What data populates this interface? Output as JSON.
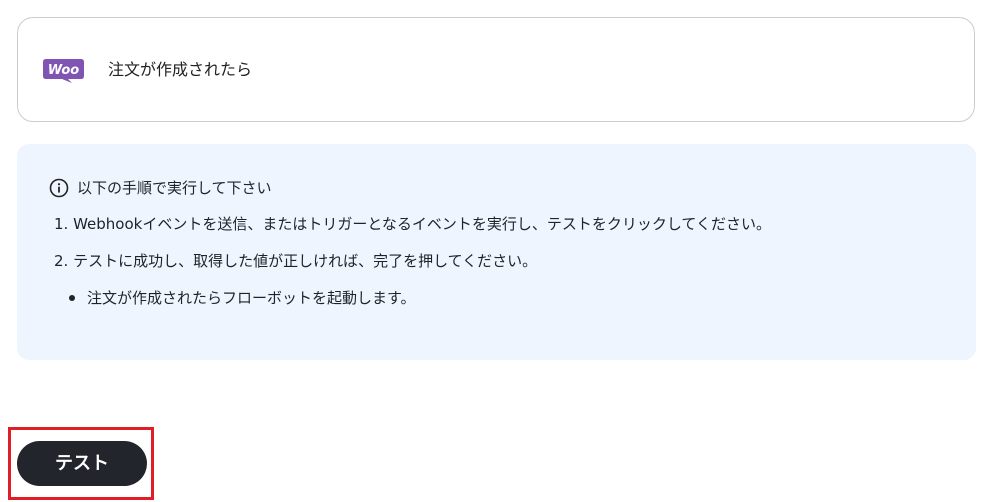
{
  "trigger": {
    "app_icon": "woocommerce-logo",
    "logo_text": "Woo",
    "label": "注文が作成されたら"
  },
  "instructions": {
    "icon": "info-icon",
    "heading": "以下の手順で実行して下さい",
    "steps": [
      "1. Webhookイベントを送信、またはトリガーとなるイベントを実行し、テストをクリックしてください。",
      "2. テストに成功し、取得した値が正しければ、完了を押してください。"
    ],
    "bullets": [
      "注文が作成されたらフローボットを起動します。"
    ]
  },
  "actions": {
    "test_label": "テスト"
  },
  "colors": {
    "woo_purple": "#7f54b3",
    "info_bg": "#eef5fe",
    "button_bg": "#22262c",
    "highlight_red": "#e01e26",
    "card_border": "#c9ccd1"
  }
}
